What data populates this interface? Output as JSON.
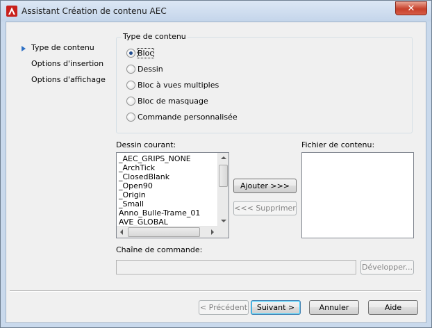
{
  "window": {
    "title": "Assistant Création de contenu AEC",
    "close_glyph": "✕",
    "app_icon": "autocad-a-icon",
    "accent": "#2d6fc4"
  },
  "nav": {
    "items": [
      {
        "label": "Type de contenu",
        "current": true
      },
      {
        "label": "Options d'insertion",
        "current": false
      },
      {
        "label": "Options d'affichage",
        "current": false
      }
    ]
  },
  "content_type": {
    "legend": "Type de contenu",
    "options": [
      {
        "label": "Bloc",
        "checked": true
      },
      {
        "label": "Dessin",
        "checked": false
      },
      {
        "label": "Bloc à vues multiples",
        "checked": false
      },
      {
        "label": "Bloc de masquage",
        "checked": false
      },
      {
        "label": "Commande personnalisée",
        "checked": false
      }
    ]
  },
  "current_drawing": {
    "label": "Dessin courant:",
    "items": [
      "_AEC_GRIPS_NONE",
      "_ArchTick",
      "_ClosedBlank",
      "_Open90",
      "_Origin",
      "_Small",
      "Anno_Bulle-Trame_01",
      "AVE_GLOBAL"
    ]
  },
  "actions": {
    "add": "Ajouter >>>",
    "remove": "<<< Supprimer"
  },
  "content_file": {
    "label": "Fichier de contenu:"
  },
  "command_string": {
    "label": "Chaîne de commande:",
    "value": "",
    "expand": "Développer..."
  },
  "footer": {
    "previous": "< Précédent",
    "next": "Suivant >",
    "cancel": "Annuler",
    "help": "Aide"
  }
}
